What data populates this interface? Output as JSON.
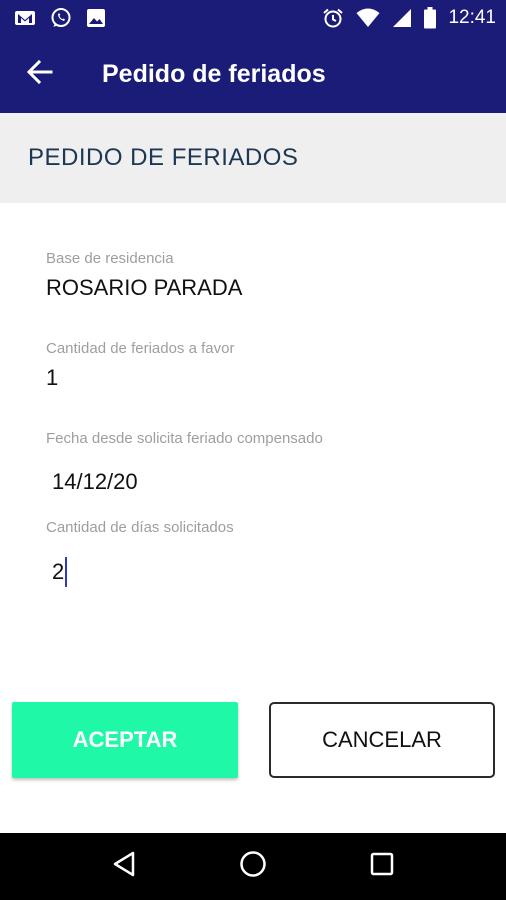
{
  "status_bar": {
    "time": "12:41",
    "left_icons": [
      "gmail-icon",
      "whatsapp-icon",
      "gallery-icon"
    ],
    "right_icons": [
      "alarm-icon",
      "wifi-icon",
      "signal-icon",
      "battery-icon"
    ]
  },
  "toolbar": {
    "title": "Pedido de feriados",
    "back_icon": "arrow-back-icon"
  },
  "section": {
    "title": "PEDIDO DE FERIADOS"
  },
  "form": {
    "base": {
      "label": "Base de residencia",
      "value": "ROSARIO PARADA"
    },
    "cantidad_favor": {
      "label": "Cantidad de feriados a favor",
      "value": "1"
    },
    "fecha": {
      "label": "Fecha desde solicita feriado compensado",
      "value": "14/12/20"
    },
    "dias": {
      "label": "Cantidad de días solicitados",
      "value": "2"
    }
  },
  "buttons": {
    "accept": "ACEPTAR",
    "cancel": "CANCELAR"
  },
  "colors": {
    "app_bar": "#1b1b78",
    "accent": "#1ff8a7",
    "section_bg": "#efefef",
    "section_text": "#1d3654",
    "caret": "#2b39c5"
  },
  "nav_bar": [
    "back-triangle-icon",
    "home-circle-icon",
    "recents-square-icon"
  ]
}
